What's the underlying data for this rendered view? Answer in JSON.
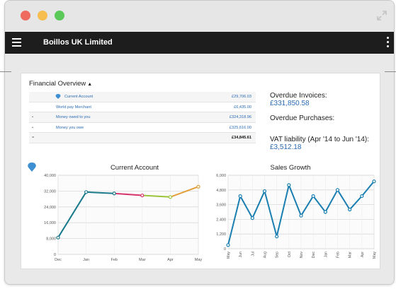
{
  "window": {
    "title": "Boillos UK Limited"
  },
  "financial_overview": {
    "title": "Financial Overview",
    "accounts": [
      {
        "bullet": "",
        "name": "Current Account",
        "amount": "£29,706.03",
        "has_logo": true
      },
      {
        "bullet": "",
        "name": "World pay Merchant",
        "amount": "£6,435.00"
      },
      {
        "bullet": "•",
        "name": "Money owed to you",
        "amount": "£324,318.96"
      },
      {
        "bullet": "•",
        "name": "Money you owe",
        "amount": "£325,616.00"
      },
      {
        "bullet": "=",
        "name": "",
        "amount": "£34,845.61"
      }
    ],
    "overdue_invoices_label": "Overdue Invoices:",
    "overdue_invoices_value": "£331,850.58",
    "overdue_purchases_label": "Overdue Purchases:",
    "vat_label": "VAT liability (Apr '14 to Jun '14):",
    "vat_value": "£3,512.18"
  },
  "chart_data": [
    {
      "type": "line",
      "title": "Current Account",
      "categories": [
        "Dec",
        "Jan",
        "Feb",
        "Mar",
        "Apr",
        "May"
      ],
      "values": [
        8500,
        31500,
        30800,
        29800,
        29000,
        34200
      ],
      "ylim": [
        0,
        40000
      ],
      "yticks": [
        "40,000",
        "32,000",
        "24,000",
        "16,000",
        "8,000",
        "0"
      ],
      "segment_colors": [
        "#1a7a8c",
        "#1a7a8c",
        "#d6336c",
        "#9ac53a",
        "#e3a03a"
      ],
      "grid": true
    },
    {
      "type": "line",
      "title": "Sales Growth",
      "categories": [
        "May",
        "Jun",
        "Jul",
        "Aug",
        "Sep",
        "Oct",
        "Nov",
        "Dec",
        "Jan",
        "Feb",
        "Mar",
        "Apr",
        "May"
      ],
      "values": [
        300,
        4300,
        2500,
        4700,
        1000,
        5200,
        2700,
        4300,
        3000,
        4800,
        3200,
        4300,
        5500
      ],
      "ylim": [
        0,
        6000
      ],
      "yticks": [
        "6,000",
        "4,800",
        "3,600",
        "2,400",
        "1,200",
        "0"
      ],
      "color": "#1a7fb0",
      "grid": true
    }
  ]
}
